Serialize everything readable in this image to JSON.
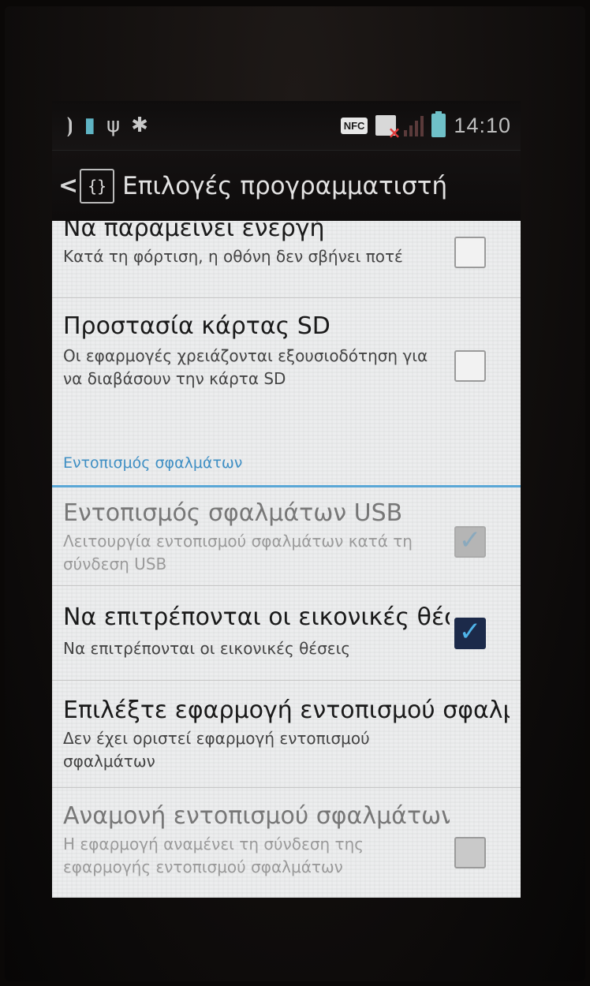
{
  "statusbar": {
    "left_icons": [
      "signal-waves-icon",
      "sd-card-icon",
      "usb-icon",
      "android-debug-icon"
    ],
    "nfc_label": "NFC",
    "time": "14:10"
  },
  "actionbar": {
    "back_symbol": "<",
    "app_icon_symbol": "{}",
    "title": "Επιλογές προγραμματιστή"
  },
  "prefs": [
    {
      "title": "Να παραμείνει ενεργή",
      "summary": "Κατά τη φόρτιση, η οθόνη δεν σβήνει ποτέ",
      "checked": false,
      "enabled": true
    },
    {
      "title": "Προστασία κάρτας SD",
      "summary": "Οι εφαρμογές χρειάζονται εξουσιοδότηση για να διαβάσουν την κάρτα SD",
      "checked": false,
      "enabled": true
    },
    {
      "title": "Εντοπισμός σφαλμάτων USB",
      "summary": "Λειτουργία εντοπισμού σφαλμάτων κατά τη σύνδεση USB",
      "checked": true,
      "enabled": false
    },
    {
      "title": "Να επιτρέπονται οι εικονικές θέσεις",
      "summary": "Να επιτρέπονται οι εικονικές θέσεις",
      "checked": true,
      "enabled": true
    },
    {
      "title": "Επιλέξτε εφαρμογή εντοπισμού σφαλμάτων",
      "summary": "Δεν έχει οριστεί εφαρμογή εντοπισμού σφαλμάτων",
      "enabled": true
    },
    {
      "title": "Αναμονή εντοπισμού σφαλμάτων",
      "summary": "Η εφαρμογή αναμένει τη σύνδεση της εφαρμογής εντοπισμού σφαλμάτων",
      "checked": false,
      "enabled": false
    }
  ],
  "category": {
    "label": "Εντοπισμός σφαλμάτων"
  },
  "colors": {
    "accent": "#3f8fc4",
    "checkbox_checked": "#1c2a4a",
    "tick": "#4fb3e8"
  }
}
